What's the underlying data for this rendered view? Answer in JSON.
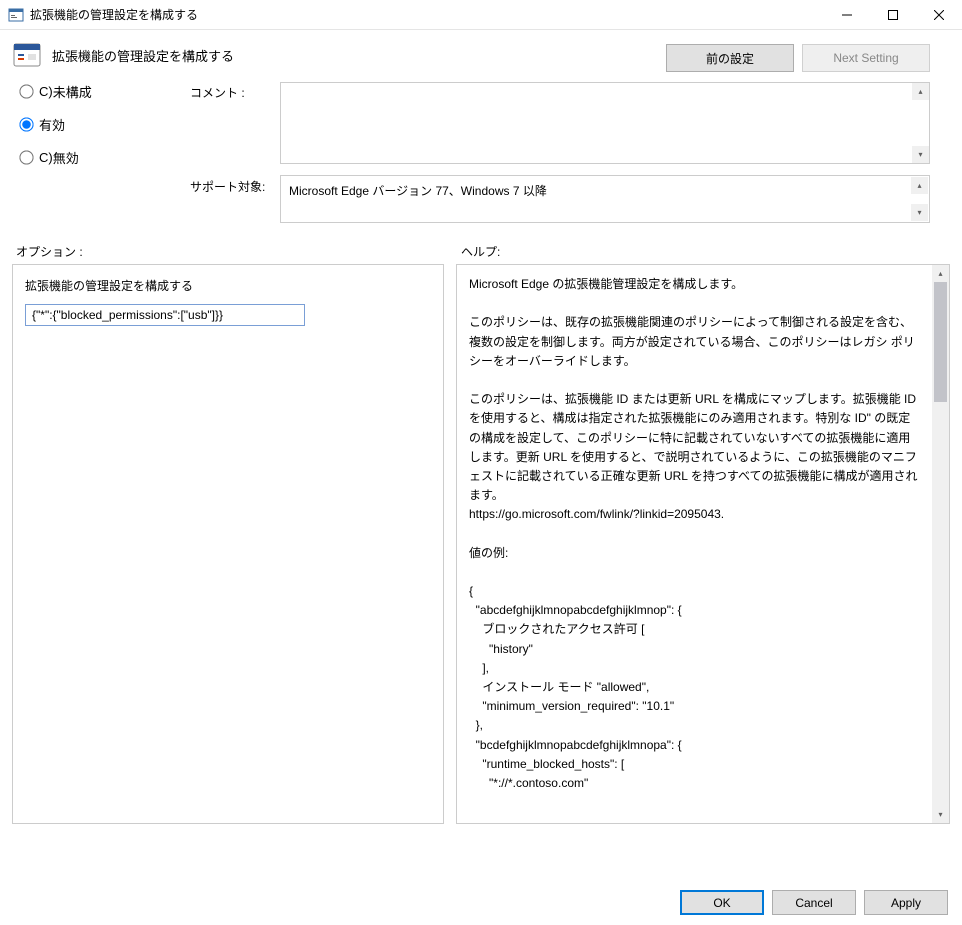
{
  "window": {
    "title": "拡張機能の管理設定を構成する",
    "minimize": "―",
    "maximize": "☐",
    "close": "✕"
  },
  "header": {
    "policy_title": "拡張機能の管理設定を構成する",
    "prev_button": "前の設定",
    "next_button": "Next Setting"
  },
  "state": {
    "not_configured_label": "未構成",
    "enabled_label": "有効",
    "disabled_label": "無効",
    "selected": "enabled"
  },
  "comment": {
    "label": "コメント :",
    "value": ""
  },
  "supported": {
    "label": "サポート対象:",
    "value": "Microsoft Edge バージョン 77、Windows 7 以降"
  },
  "sections": {
    "options_label": "オプション :",
    "help_label": "ヘルプ:"
  },
  "options_panel": {
    "field_label": "拡張機能の管理設定を構成する",
    "field_value": "{\"*\":{\"blocked_permissions\":[\"usb\"]}}"
  },
  "help_panel": {
    "text": "Microsoft Edge の拡張機能管理設定を構成します。\n\nこのポリシーは、既存の拡張機能関連のポリシーによって制御される設定を含む、複数の設定を制御します。両方が設定されている場合、このポリシーはレガシ ポリシーをオーバーライドします。\n\nこのポリシーは、拡張機能 ID または更新 URL を構成にマップします。拡張機能 ID を使用すると、構成は指定された拡張機能にのみ適用されます。特別な ID\" の既定の構成を設定して、このポリシーに特に記載されていないすべての拡張機能に適用します。更新 URL を使用すると、で説明されているように、この拡張機能のマニフェストに記載されている正確な更新 URL を持つすべての拡張機能に構成が適用されます。\nhttps://go.microsoft.com/fwlink/?linkid=2095043.\n\n値の例:\n\n{\n  \"abcdefghijklmnopabcdefghijklmnop\": {\n    ブロックされたアクセス許可 [\n      \"history\"\n    ],\n    インストール モード \"allowed\",\n    \"minimum_version_required\": \"10.1\"\n  },\n  \"bcdefghijklmnopabcdefghijklmnopa\": {\n    \"runtime_blocked_hosts\": [\n      \"*://*.contoso.com\""
  },
  "footer": {
    "ok": "OK",
    "cancel": "Cancel",
    "apply": "Apply"
  }
}
